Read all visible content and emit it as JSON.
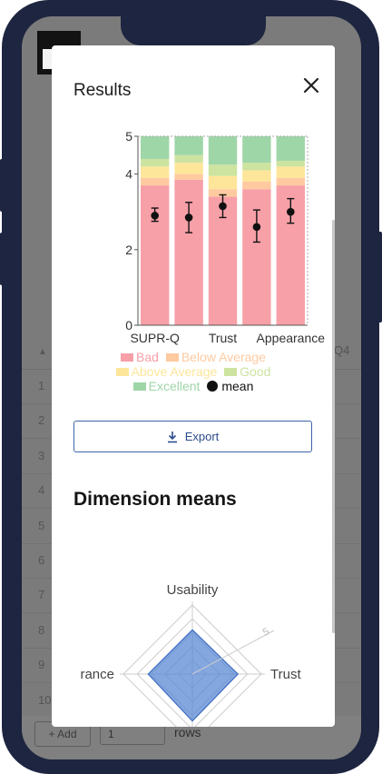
{
  "background_app": {
    "sort_indicator": "▲",
    "last_col_label": "Q4",
    "row_numbers": [
      "1",
      "2",
      "3",
      "4",
      "5",
      "6",
      "7",
      "8",
      "9",
      "10"
    ],
    "add_label": "Add",
    "rows_value": "1",
    "rows_label": "rows"
  },
  "modal": {
    "title": "Results",
    "close_icon": "close-icon",
    "export_label": "Export",
    "export_icon": "download-icon",
    "section_heading": "Dimension means"
  },
  "colors": {
    "bad": "#f7a0a8",
    "below_average": "#ffcaa0",
    "above_average": "#fde59a",
    "good": "#cde3a0",
    "excellent": "#9fd6a8",
    "mean": "#111111",
    "radar_fill": "#5b8ad6",
    "export_accent": "#3b64a8"
  },
  "legend": {
    "bad": "Bad",
    "below_average": "Below Average",
    "above_average": "Above Average",
    "good": "Good",
    "excellent": "Excellent",
    "mean": "mean"
  },
  "chart_data": [
    {
      "type": "bar",
      "stacked": true,
      "categories": [
        "SUPR-Q",
        "",
        "Trust",
        "",
        "Appearance"
      ],
      "ylim": [
        0,
        5
      ],
      "yticks": [
        0,
        2,
        4,
        5
      ],
      "grid": false,
      "legend_placement": "bottom",
      "series": [
        {
          "name": "Bad",
          "values": [
            3.7,
            3.85,
            3.4,
            3.6,
            3.7
          ]
        },
        {
          "name": "Below Average",
          "values": [
            0.2,
            0.15,
            0.2,
            0.2,
            0.2
          ]
        },
        {
          "name": "Above Average",
          "values": [
            0.3,
            0.3,
            0.35,
            0.3,
            0.3
          ]
        },
        {
          "name": "Good",
          "values": [
            0.2,
            0.2,
            0.3,
            0.2,
            0.15
          ]
        },
        {
          "name": "Excellent",
          "values": [
            0.6,
            0.5,
            0.75,
            0.7,
            0.65
          ]
        }
      ],
      "mean": {
        "name": "mean",
        "values": [
          2.9,
          2.85,
          3.15,
          2.6,
          3.0
        ],
        "err_low": [
          2.75,
          2.45,
          2.85,
          2.2,
          2.7
        ],
        "err_high": [
          3.1,
          3.25,
          3.45,
          3.05,
          3.35
        ]
      }
    },
    {
      "type": "radar",
      "axes": [
        "Usability",
        "Trust",
        "",
        "rance"
      ],
      "values": [
        3.2,
        3.3,
        3.4,
        3.2
      ],
      "range": [
        0,
        5
      ],
      "tick_label": "5"
    }
  ]
}
